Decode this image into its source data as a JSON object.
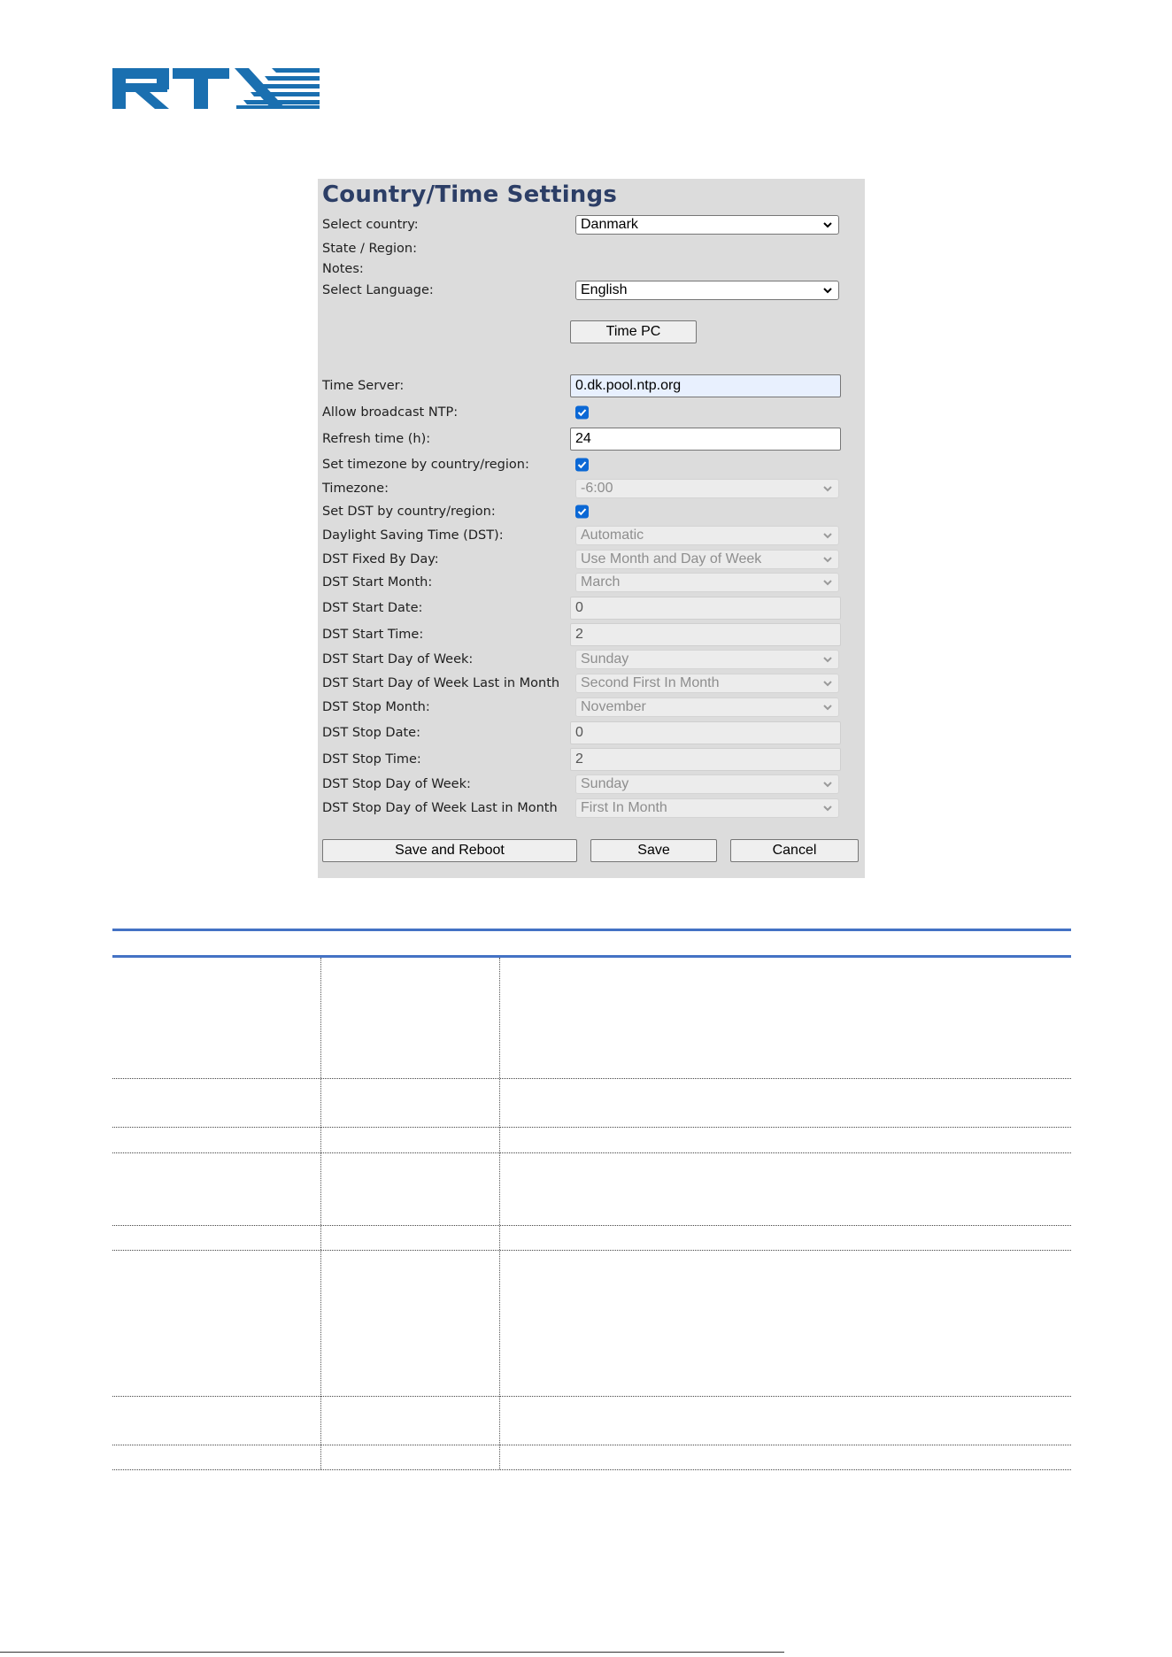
{
  "panel": {
    "title": "Country/Time Settings",
    "select_country": {
      "label": "Select country:",
      "value": "Danmark"
    },
    "state_region": {
      "label": "State / Region:"
    },
    "notes": {
      "label": "Notes:"
    },
    "select_language": {
      "label": "Select Language:",
      "value": "English"
    },
    "time_pc_button": "Time PC",
    "time_server": {
      "label": "Time Server:",
      "value": "0.dk.pool.ntp.org"
    },
    "allow_broadcast_ntp": {
      "label": "Allow broadcast NTP:",
      "checked": true
    },
    "refresh_time": {
      "label": "Refresh time (h):",
      "value": "24"
    },
    "set_timezone": {
      "label": "Set timezone by country/region:",
      "checked": true
    },
    "timezone": {
      "label": "Timezone:",
      "value": "-6:00"
    },
    "set_dst": {
      "label": "Set DST by country/region:",
      "checked": true
    },
    "dst_mode": {
      "label": "Daylight Saving Time (DST):",
      "value": "Automatic"
    },
    "dst_fixed_by_day": {
      "label": "DST Fixed By Day:",
      "value": "Use Month and Day of Week"
    },
    "dst_start_month": {
      "label": "DST Start Month:",
      "value": "March"
    },
    "dst_start_date": {
      "label": "DST Start Date:",
      "value": "0"
    },
    "dst_start_time": {
      "label": "DST Start Time:",
      "value": "2"
    },
    "dst_start_dow": {
      "label": "DST Start Day of Week:",
      "value": "Sunday"
    },
    "dst_start_dow_last": {
      "label": "DST Start Day of Week Last in Month",
      "value": "Second First In Month"
    },
    "dst_stop_month": {
      "label": "DST Stop Month:",
      "value": "November"
    },
    "dst_stop_date": {
      "label": "DST Stop Date:",
      "value": "0"
    },
    "dst_stop_time": {
      "label": "DST Stop Time:",
      "value": "2"
    },
    "dst_stop_dow": {
      "label": "DST Stop Day of Week:",
      "value": "Sunday"
    },
    "dst_stop_dow_last": {
      "label": "DST Stop Day of Week Last in Month",
      "value": "First In Month"
    },
    "buttons": {
      "save_reboot": "Save and Reboot",
      "save": "Save",
      "cancel": "Cancel"
    }
  },
  "colors": {
    "panel_bg": "#dcdcdc",
    "title": "#2c3e66",
    "checkbox": "#0b68d5",
    "logo": "#1a6fb0",
    "table_rule": "#4472c4"
  }
}
